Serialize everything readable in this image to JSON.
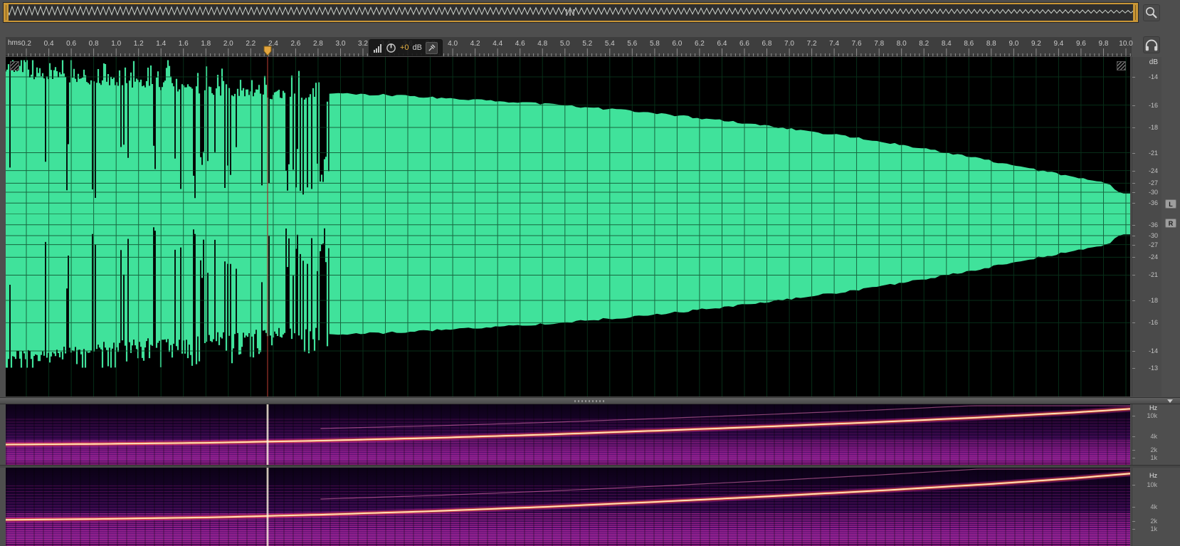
{
  "navigator": {
    "description": "zoom navigator overview strip",
    "frame_color": "#c99636"
  },
  "timeline": {
    "unit": "hms",
    "tick_labels": [
      "0.2",
      "0.4",
      "0.6",
      "0.8",
      "1.0",
      "1.2",
      "1.4",
      "1.6",
      "1.8",
      "2.0",
      "2.2",
      "2.4",
      "2.6",
      "2.8",
      "3.0",
      "3.2",
      "3.4",
      "3.6",
      "3.8",
      "4.0",
      "4.2",
      "4.4",
      "4.6",
      "4.8",
      "5.0",
      "5.2",
      "5.4",
      "5.6",
      "5.8",
      "6.0",
      "6.2",
      "6.4",
      "6.6",
      "6.8",
      "7.0",
      "7.2",
      "7.4",
      "7.6",
      "7.8",
      "8.0",
      "8.2",
      "8.4",
      "8.6",
      "8.8",
      "9.0",
      "9.2",
      "9.4",
      "9.6",
      "9.8",
      "10.0"
    ],
    "playhead_time": 2.35
  },
  "hud": {
    "gain_value": "+0",
    "gain_unit": "dB"
  },
  "waveform": {
    "color": "#40e29b",
    "background": "#000000",
    "grid_color": "rgba(10,62,32,0.75)",
    "center_line_color": "rgba(30,130,75,0.8)",
    "playhead_color": "#9e332b",
    "spike_region_end": 2.95,
    "envelope": [
      [
        0,
        0.97
      ],
      [
        0.3,
        0.95
      ],
      [
        0.6,
        0.92
      ],
      [
        1.0,
        0.895
      ],
      [
        1.4,
        0.865
      ],
      [
        1.8,
        0.84
      ],
      [
        2.2,
        0.815
      ],
      [
        2.6,
        0.795
      ],
      [
        3.0,
        0.785
      ],
      [
        3.5,
        0.77
      ],
      [
        4.0,
        0.75
      ],
      [
        4.5,
        0.73
      ],
      [
        5.0,
        0.705
      ],
      [
        5.5,
        0.675
      ],
      [
        6.0,
        0.64
      ],
      [
        6.5,
        0.6
      ],
      [
        7.0,
        0.555
      ],
      [
        7.5,
        0.505
      ],
      [
        8.0,
        0.45
      ],
      [
        8.4,
        0.4
      ],
      [
        8.8,
        0.345
      ],
      [
        9.1,
        0.3
      ],
      [
        9.4,
        0.26
      ],
      [
        9.6,
        0.235
      ],
      [
        9.75,
        0.21
      ],
      [
        9.85,
        0.19
      ],
      [
        9.95,
        0.14
      ],
      [
        10.05,
        0.13
      ]
    ]
  },
  "amplitude_ruler": {
    "title": "dB",
    "db_labels_top": [
      "-14",
      "-16",
      "-18",
      "-21",
      "-24",
      "-27",
      "-30",
      "-36"
    ],
    "db_labels_bottom": [
      "-36",
      "-30",
      "-27",
      "-24",
      "-21",
      "-18",
      "-16",
      "-14",
      "-13"
    ],
    "edge_db": -13
  },
  "channel_buttons": {
    "left_label": "L",
    "right_label": "R"
  },
  "spectrogram": {
    "ruler_title": "Hz",
    "freq_labels": [
      "10k",
      "4k",
      "2k",
      "1k"
    ],
    "sweep_points": [
      [
        0,
        0.665
      ],
      [
        0.08,
        0.655
      ],
      [
        0.18,
        0.635
      ],
      [
        0.28,
        0.6
      ],
      [
        0.38,
        0.555
      ],
      [
        0.48,
        0.5
      ],
      [
        0.58,
        0.435
      ],
      [
        0.68,
        0.365
      ],
      [
        0.78,
        0.29
      ],
      [
        0.88,
        0.205
      ],
      [
        0.95,
        0.135
      ],
      [
        1,
        0.075
      ]
    ],
    "sweep_core_color": "#ffe9c0",
    "sweep_glow_color": "#ff6a28",
    "sweep_outer_glow": "#d8289a",
    "harmonic_color": "rgba(255,130,200,0.5)",
    "playhead_color": "#fff6e0"
  }
}
